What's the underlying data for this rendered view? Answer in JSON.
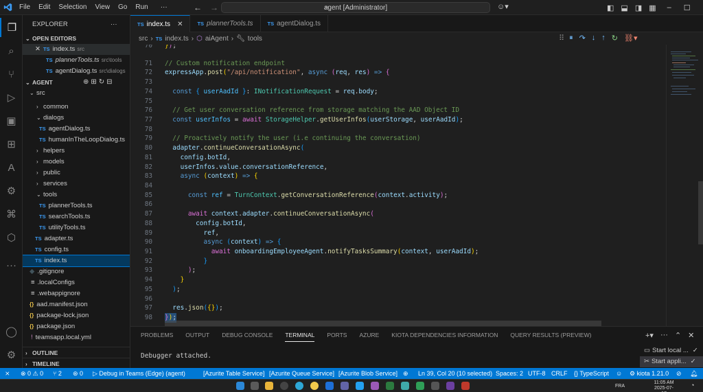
{
  "titlebar": {
    "menu": [
      "File",
      "Edit",
      "Selection",
      "View",
      "Go",
      "Run",
      "···"
    ],
    "search_text": "agent [Administrator]"
  },
  "sidebar": {
    "explorer_title": "EXPLORER",
    "open_editors_title": "OPEN EDITORS",
    "open_editors": [
      {
        "name": "index.ts",
        "path": "src"
      },
      {
        "name": "plannerTools.ts",
        "path": "src\\tools"
      },
      {
        "name": "agentDialog.ts",
        "path": "src\\dialogs"
      }
    ],
    "agent_title": "AGENT",
    "tree": [
      {
        "label": "src",
        "kind": "folder-open"
      },
      {
        "label": "common",
        "kind": "folder"
      },
      {
        "label": "dialogs",
        "kind": "folder-open"
      },
      {
        "label": "agentDialog.ts",
        "kind": "ts"
      },
      {
        "label": "humanInTheLoopDialog.ts",
        "kind": "ts"
      },
      {
        "label": "helpers",
        "kind": "folder"
      },
      {
        "label": "models",
        "kind": "folder"
      },
      {
        "label": "public",
        "kind": "folder"
      },
      {
        "label": "services",
        "kind": "folder"
      },
      {
        "label": "tools",
        "kind": "folder-open"
      },
      {
        "label": "plannerTools.ts",
        "kind": "ts"
      },
      {
        "label": "searchTools.ts",
        "kind": "ts"
      },
      {
        "label": "utilityTools.ts",
        "kind": "ts"
      },
      {
        "label": "adapter.ts",
        "kind": "ts"
      },
      {
        "label": "config.ts",
        "kind": "ts"
      },
      {
        "label": "index.ts",
        "kind": "ts"
      },
      {
        "label": ".gitignore",
        "kind": "git"
      },
      {
        "label": ".localConfigs",
        "kind": "file"
      },
      {
        "label": ".webappignore",
        "kind": "file"
      },
      {
        "label": "aad.manifest.json",
        "kind": "json"
      },
      {
        "label": "package-lock.json",
        "kind": "json"
      },
      {
        "label": "package.json",
        "kind": "json"
      },
      {
        "label": "teamsapp.local.yml",
        "kind": "yml"
      }
    ],
    "outline_title": "OUTLINE",
    "timeline_title": "TIMELINE"
  },
  "tabs": [
    {
      "label": "index.ts",
      "italic": false,
      "active": true
    },
    {
      "label": "plannerTools.ts",
      "italic": true,
      "active": false
    },
    {
      "label": "agentDialog.ts",
      "italic": false,
      "active": false
    }
  ],
  "breadcrumb": [
    "src",
    "index.ts",
    "aiAgent",
    "tools"
  ],
  "code": {
    "line_numbers": [
      70,
      71,
      72,
      73,
      74,
      75,
      76,
      77,
      78,
      79,
      80,
      81,
      82,
      83,
      84,
      85,
      86,
      87,
      88,
      89,
      90,
      91,
      92,
      93,
      94,
      95,
      96,
      97,
      98
    ],
    "lines": [
      "}));",
      "// Custom notification endpoint",
      "expressApp.post(\"/api/notification\", async (req, res) => {",
      "",
      "  const { userAadId } = INotificationRequest = req.body;",
      "",
      "  // Get user conversation reference from storage matching the AAD Object ID",
      "  const userInfos = await StorageHelper.getUserInfos(userStorage, userAadId);",
      "",
      "  // Proactively notify the user (i.e continuing the conversation)",
      "  adapter.continueConversationAsync(",
      "    config.botId,",
      "    userInfos.value.conversationReference,",
      "    async (context) => {",
      "",
      "      const ref = TurnContext.getConversationReference(context.activity);",
      "",
      "      await context.adapter.continueConversationAsync(",
      "        config.botId,",
      "          ref,",
      "          async (context) => {",
      "            await onboardingEmployeeAgent.notifyTasksSummary(context, userAadId);",
      "          }",
      "      );",
      "    }",
      "  );",
      "",
      "  res.json({});",
      "});"
    ]
  },
  "panel": {
    "tabs": [
      "PROBLEMS",
      "OUTPUT",
      "DEBUG CONSOLE",
      "TERMINAL",
      "PORTS",
      "AZURE",
      "KIOTA DEPENDENCIES INFORMATION",
      "QUERY RESULTS (PREVIEW)"
    ],
    "active_tab": "TERMINAL",
    "output": "Debugger attached.",
    "terminals": [
      "Start local ...",
      "Start appli..."
    ]
  },
  "statusbar": {
    "errors": "0",
    "warnings": "0",
    "ports": "2",
    "ports2": "0",
    "debug": "Debug in Teams (Edge) (agent)",
    "azurite_table": "[Azurite Table Service]",
    "azurite_queue": "[Azurite Queue Service]",
    "azurite_blob": "[Azurite Blob Service]",
    "position": "Ln 39, Col 20 (10 selected)",
    "spaces": "Spaces: 2",
    "encoding": "UTF-8",
    "eol": "CRLF",
    "language": "TypeScript",
    "kiota": "kiota 1.21.0"
  },
  "taskbar": {
    "lang": "FRA",
    "time": "11:05 AM",
    "date": "2025-07-17"
  },
  "colors": {
    "accent": "#0078d4",
    "statusbar": "#0078d4",
    "editor_bg": "#1f1f1f",
    "sidebar_bg": "#181818"
  }
}
